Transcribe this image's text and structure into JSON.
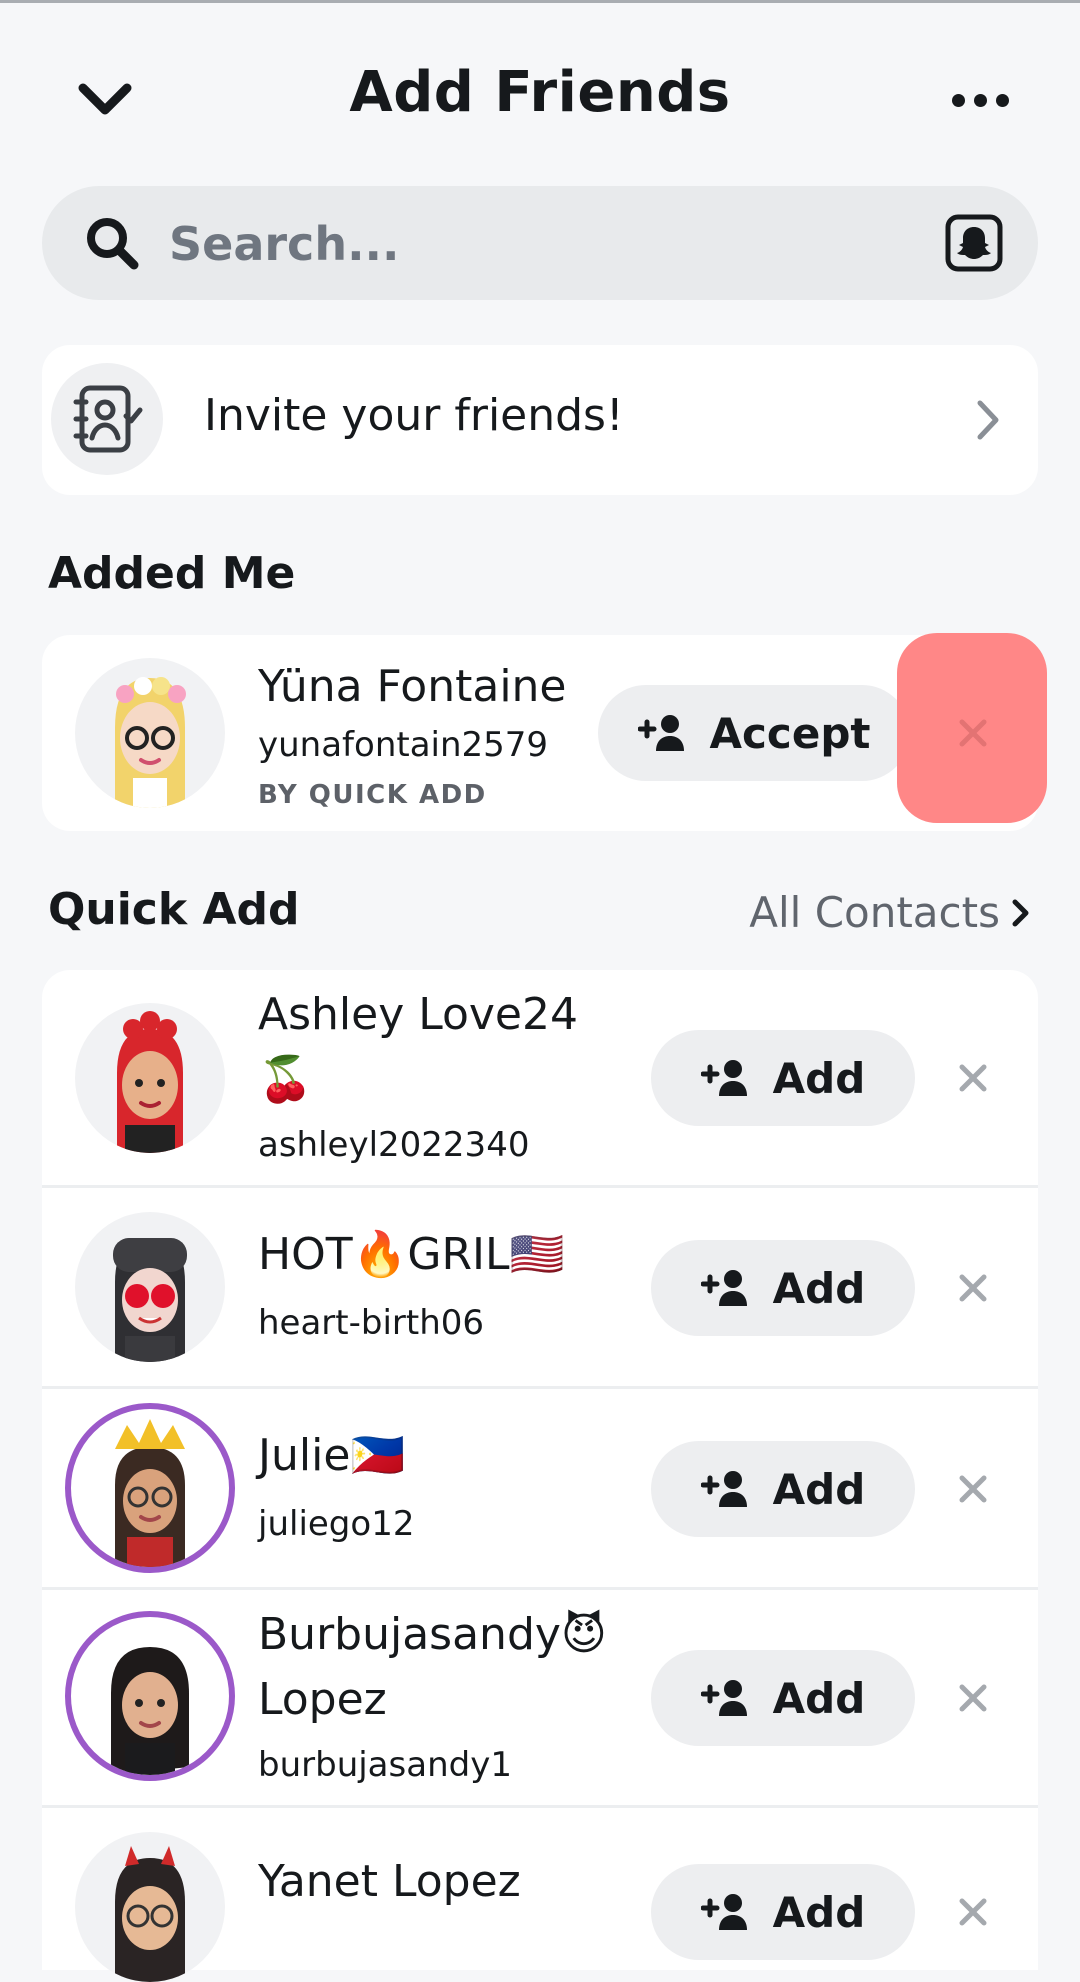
{
  "header": {
    "title": "Add Friends"
  },
  "search": {
    "placeholder": "Search..."
  },
  "invite": {
    "label": "Invite your friends!"
  },
  "added_me": {
    "section_title": "Added Me",
    "items": [
      {
        "name": "Yüna Fontaine",
        "username": "yunafontain2579",
        "source": "BY QUICK ADD",
        "action_label": "Accept"
      }
    ]
  },
  "quick_add": {
    "section_title": "Quick Add",
    "all_contacts_label": "All Contacts",
    "items": [
      {
        "name": "Ashley Love24",
        "name_line2": "🍒",
        "username": "ashleyl2022340",
        "action_label": "Add"
      },
      {
        "name": "HOT🔥GRIL🇺🇸",
        "username": "heart-birth06",
        "action_label": "Add"
      },
      {
        "name": "Julie🇵🇭",
        "username": "juliego12",
        "action_label": "Add"
      },
      {
        "name": "Burbujasandy😈",
        "name_line2": "Lopez",
        "username": "burbujasandy1",
        "action_label": "Add"
      },
      {
        "name": "Yanet Lopez",
        "action_label": "Add"
      }
    ]
  },
  "colors": {
    "highlight": "#ff8787",
    "pill_bg": "#edeef0",
    "story_ring": "#9b59c9"
  }
}
